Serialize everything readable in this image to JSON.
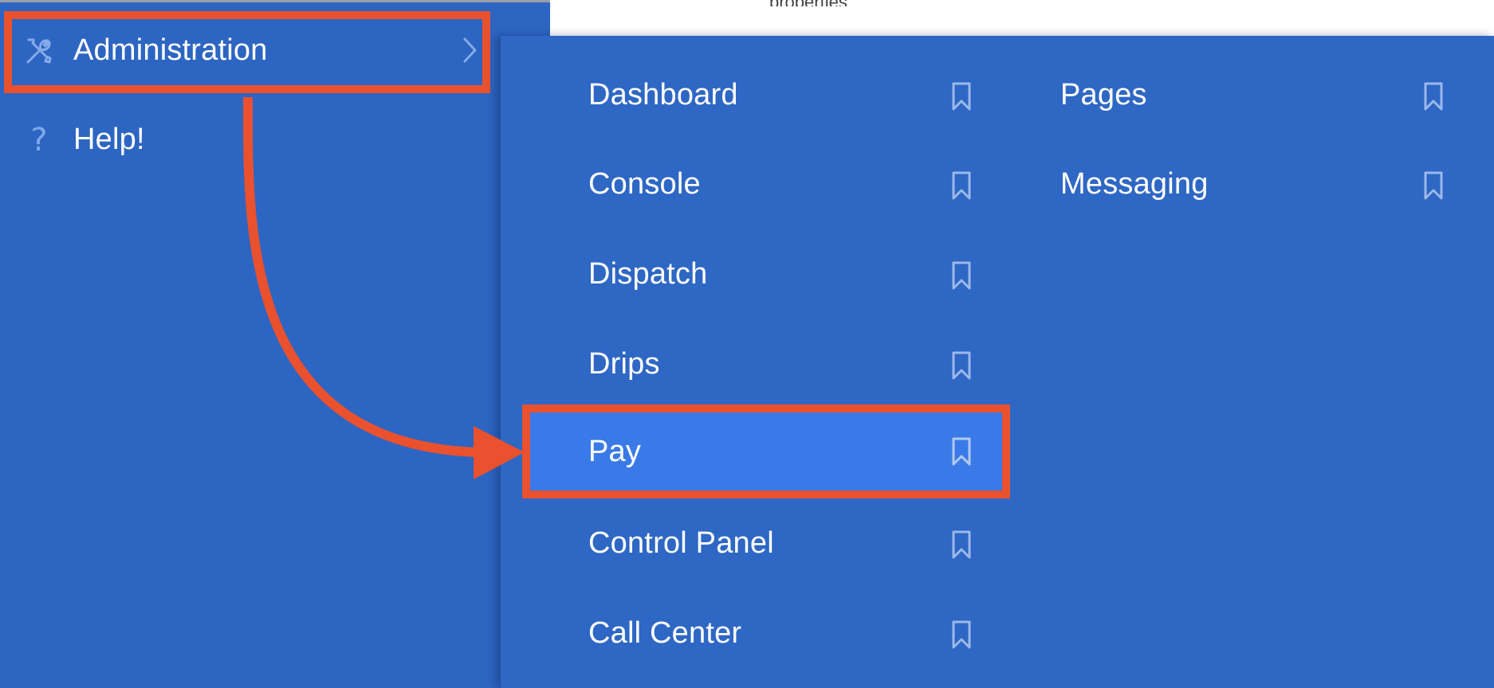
{
  "header": {
    "fragment_text": "properties"
  },
  "sidebar": {
    "items": [
      {
        "label": "Administration",
        "icon": "tools-icon"
      },
      {
        "label": "Help!",
        "icon": "question-icon"
      }
    ]
  },
  "submenu": {
    "column1": [
      {
        "label": "Dashboard"
      },
      {
        "label": "Console"
      },
      {
        "label": "Dispatch"
      },
      {
        "label": "Drips"
      },
      {
        "label": "Pay",
        "active": true
      },
      {
        "label": "Control Panel"
      },
      {
        "label": "Call Center"
      }
    ],
    "column2": [
      {
        "label": "Pages"
      },
      {
        "label": "Messaging"
      }
    ]
  },
  "colors": {
    "sidebar_bg": "#2d65c2",
    "panel_bg": "#2e67c4",
    "active_bg": "#3a7ae8",
    "annotation": "#e9512f",
    "icon_muted": "#7fa8ea"
  }
}
